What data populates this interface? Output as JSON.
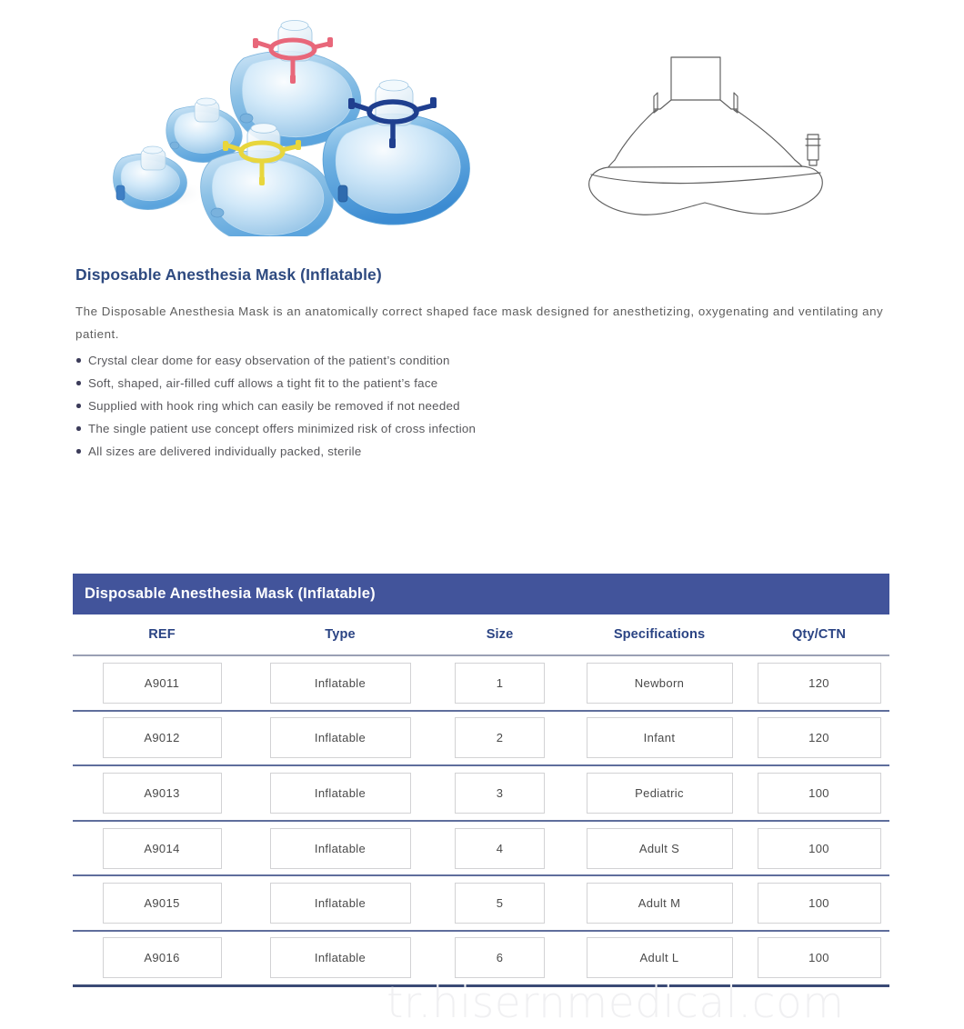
{
  "hero": {
    "product_photo_alt": "five inflatable anesthesia masks of graduated sizes",
    "line_drawing_alt": "technical side-profile line drawing of inflatable anesthesia mask"
  },
  "copy": {
    "title": "Disposable Anesthesia Mask (Inflatable)",
    "intro": "The Disposable Anesthesia Mask is an anatomically correct shaped face mask designed for anesthetizing, oxygenating and ventilating any patient.",
    "features": [
      "Crystal clear dome for easy observation of the patient’s condition",
      "Soft, shaped, air-filled cuff allows a tight fit to the patient’s face",
      "Supplied with hook ring which can easily be removed if not needed",
      "The single patient use concept offers minimized risk of cross infection",
      "All sizes are delivered individually packed, sterile"
    ]
  },
  "table": {
    "caption": "Disposable Anesthesia Mask (Inflatable)",
    "columns": [
      "REF",
      "Type",
      "Size",
      "Specifications",
      "Qty/CTN"
    ],
    "rows": [
      {
        "ref": "A9011",
        "type": "Inflatable",
        "size": "1",
        "spec": "Newborn",
        "qty": "120"
      },
      {
        "ref": "A9012",
        "type": "Inflatable",
        "size": "2",
        "spec": "Infant",
        "qty": "120"
      },
      {
        "ref": "A9013",
        "type": "Inflatable",
        "size": "3",
        "spec": "Pediatric",
        "qty": "100"
      },
      {
        "ref": "A9014",
        "type": "Inflatable",
        "size": "4",
        "spec": "Adult S",
        "qty": "100"
      },
      {
        "ref": "A9015",
        "type": "Inflatable",
        "size": "5",
        "spec": "Adult M",
        "qty": "100"
      },
      {
        "ref": "A9016",
        "type": "Inflatable",
        "size": "6",
        "spec": "Adult L",
        "qty": "100"
      }
    ]
  },
  "watermark": {
    "text": "tr.hisernmedical.com"
  },
  "colors": {
    "caption_bg": "#42549b",
    "title_text": "#2e4a80",
    "header_text": "#2b4484",
    "body_text": "#5d5d5d",
    "row_divider": "#5f6e9c",
    "cell_border": "#d2d2d4",
    "watermark": "#f0f0f2",
    "mask_blue": "#a8cfeb",
    "hook_ring_pink": "#e8677a",
    "hook_ring_navy": "#1f3f8f",
    "hook_ring_yellow": "#e8d63c"
  }
}
